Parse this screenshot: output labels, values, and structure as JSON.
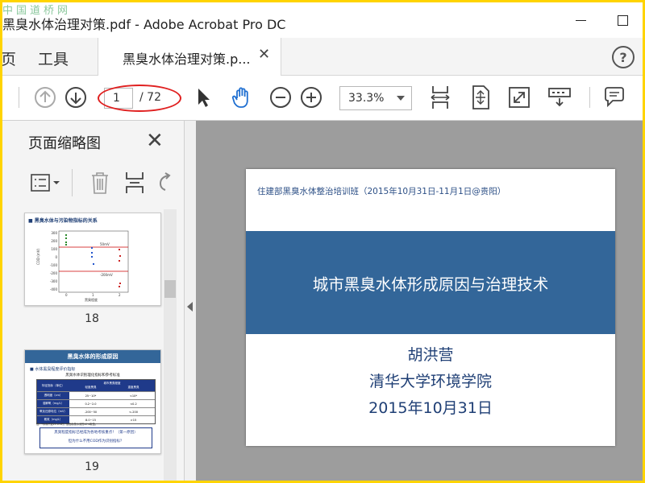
{
  "window": {
    "title": "黑臭水体治理对策.pdf - Adobe Acrobat Pro DC",
    "watermark": "中国道桥网"
  },
  "menu": {
    "items": [
      "页",
      "工具"
    ]
  },
  "tab": {
    "label": "黑臭水体治理对策.p...",
    "close_glyph": "✕"
  },
  "help_glyph": "?",
  "toolbar": {
    "current_page": "1",
    "total_pages": "/ 72",
    "zoom": "33.3%"
  },
  "sidebar": {
    "title": "页面缩略图",
    "thumbnails": [
      {
        "page": "18",
        "heading": "黑臭水体与污染物指标的关系",
        "y_axis_label": "COD (mV)",
        "x_axis_label": "黑臭程度",
        "y_ticks": [
          "300",
          "200",
          "100",
          "0",
          "-100",
          "-200",
          "-300",
          "-400"
        ],
        "x_ticks": [
          "0",
          "1",
          "2"
        ],
        "line_labels": [
          "50mV",
          "-200mV"
        ]
      },
      {
        "page": "19",
        "heading": "黑臭水体的形成原因",
        "bullet": "水体黑臭程度评价指标",
        "table_title": "黑臭水体识别理化指标和参考标准",
        "table_headers": [
          "特征指标（单位）",
          "城市黑臭程度",
          "轻度黑臭",
          "重度黑臭"
        ],
        "table_rows": [
          [
            "透明度（cm）",
            "25~10*",
            "<10*"
          ],
          [
            "溶解氧（mg/L）",
            "0.2~2.0",
            "<0.2"
          ],
          [
            "氧化还原电位（mV）",
            "-200~50",
            "<-200"
          ],
          [
            "氨氮（mg/L）",
            "8.0~15",
            ">15"
          ]
        ],
        "footnote": "注：*水深不足25 cm时，该指标按水深的40%取值。",
        "callout_line1": "黑臭程度指标已经成为各地考核重点！（第一原因）",
        "callout_line2": "但为什么不用COD作为识别指标？"
      }
    ]
  },
  "slide": {
    "header": "住建部黑臭水体整治培训班（2015年10月31日-11月1日@贵阳）",
    "title": "城市黑臭水体形成原因与治理技术",
    "author": "胡洪营",
    "affiliation": "清华大学环境学院",
    "date": "2015年10月31日"
  },
  "colors": {
    "accent_blue": "#336699",
    "annotation_red": "#e02020",
    "frame_yellow": "#ffd400"
  }
}
